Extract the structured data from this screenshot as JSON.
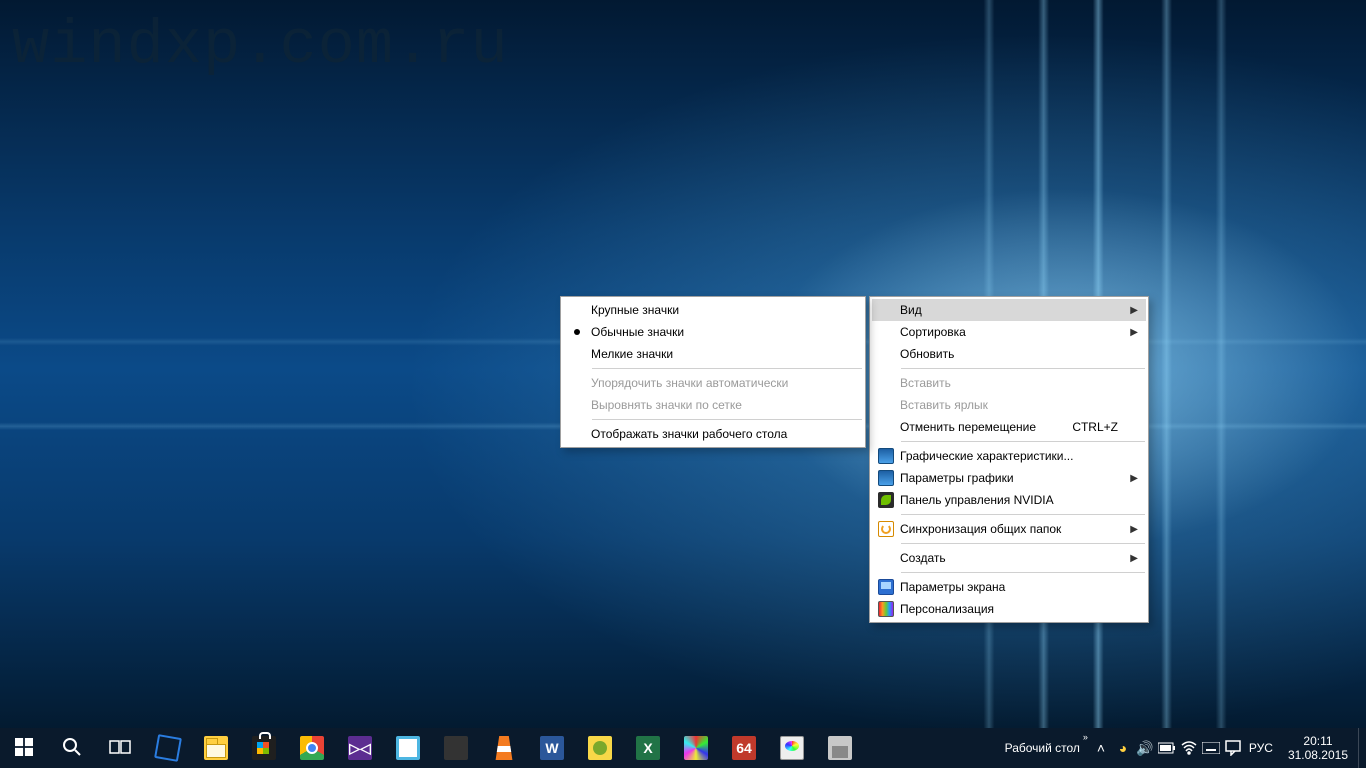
{
  "watermark": "windxp.com.ru",
  "context_menu": {
    "view": {
      "label": "Вид"
    },
    "sort": {
      "label": "Сортировка"
    },
    "refresh": {
      "label": "Обновить"
    },
    "paste": {
      "label": "Вставить"
    },
    "paste_shortcut": {
      "label": "Вставить ярлык"
    },
    "undo_move": {
      "label": "Отменить перемещение",
      "shortcut": "CTRL+Z"
    },
    "gfx_props": {
      "label": "Графические характеристики..."
    },
    "gfx_params": {
      "label": "Параметры графики"
    },
    "nvidia": {
      "label": "Панель управления NVIDIA"
    },
    "sync_shared": {
      "label": "Синхронизация общих папок"
    },
    "new": {
      "label": "Создать"
    },
    "display_settings": {
      "label": "Параметры экрана"
    },
    "personalize": {
      "label": "Персонализация"
    }
  },
  "submenu_view": {
    "large": "Крупные значки",
    "medium": "Обычные значки",
    "small": "Мелкие значки",
    "auto_arrange": "Упорядочить значки автоматически",
    "align_grid": "Выровнять значки по сетке",
    "show_icons": "Отображать значки рабочего стола"
  },
  "taskbar": {
    "toolbar_label": "Рабочий стол",
    "lang": "РУС",
    "time": "20:11",
    "date": "31.08.2015"
  }
}
